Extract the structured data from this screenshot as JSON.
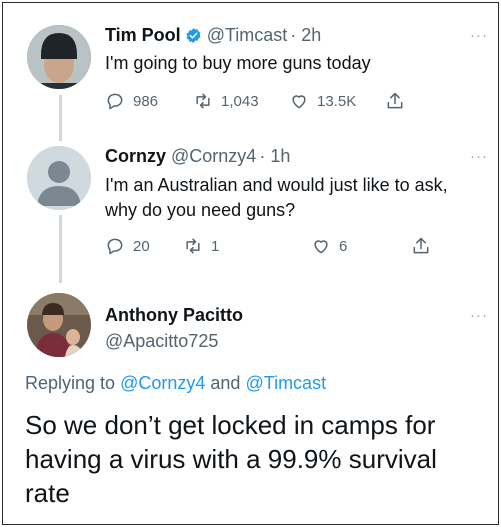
{
  "tweets": [
    {
      "name": "Tim Pool",
      "handle": "@Timcast",
      "time": "· 2h",
      "verified": true,
      "text": "I'm going to buy more guns today",
      "replies": "986",
      "retweets": "1,043",
      "likes": "13.5K"
    },
    {
      "name": "Cornzy",
      "handle": "@Cornzy4",
      "time": "· 1h",
      "verified": false,
      "text_line1": "I'm an Australian and would just like to ask,",
      "text_line2": "why do you need guns?",
      "replies": "20",
      "retweets": "1",
      "likes": "6"
    }
  ],
  "reply": {
    "name": "Anthony Pacitto",
    "handle": "@Apacitto725",
    "replying_prefix": "Replying to",
    "replying_to_1": "@Cornzy4",
    "replying_and": "and",
    "replying_to_2": "@Timcast",
    "text_line1": "So we don’t get locked in camps for",
    "text_line2": "having a virus with a 99.9% survival",
    "text_line3": "rate"
  },
  "more_label": "···",
  "colors": {
    "link": "#1d9bf0",
    "verified": "#1d9bf0",
    "muted": "#536471"
  }
}
